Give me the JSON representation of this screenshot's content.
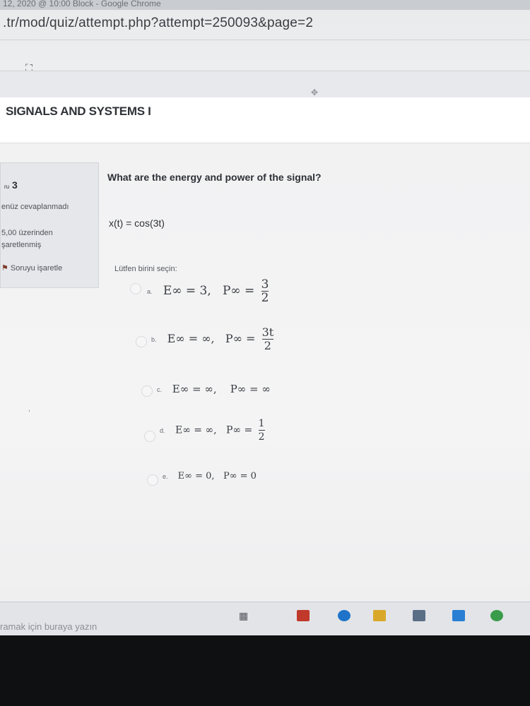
{
  "browser": {
    "tab_title": "12, 2020 @ 10:00 Block - Google Chrome",
    "url": ".tr/mod/quiz/attempt.php?attempt=250093&page=2"
  },
  "course": {
    "title": "SIGNALS AND SYSTEMS I"
  },
  "question_info": {
    "number": "3",
    "number_prefix": "ru",
    "state": "enüz cevaplanmadı",
    "grade_line1": "5,00 üzerinden",
    "grade_line2": "şaretlenmiş",
    "flag_label": "Soruyu işaretle"
  },
  "question": {
    "text": "What are the energy and power of the signal?",
    "formula": "x(t) = cos(3t)",
    "prompt": "Lütfen birini seçin:",
    "options": [
      {
        "letter": "a.",
        "energy": "E∞ = 3,",
        "power_label": "P∞ =",
        "num": "3",
        "den": "2"
      },
      {
        "letter": "b.",
        "energy": "E∞ = ∞,",
        "power_label": "P∞ =",
        "num": "3t",
        "den": "2"
      },
      {
        "letter": "c.",
        "energy": "E∞ = ∞,",
        "power_label": "P∞ = ∞"
      },
      {
        "letter": "d.",
        "energy": "E∞ = ∞,",
        "power_label": "P∞ =",
        "num": "1",
        "den": "2"
      },
      {
        "letter": "e.",
        "energy": "E∞ = 0,",
        "power_label": "P∞ = 0"
      }
    ]
  },
  "taskbar": {
    "search_placeholder": "ramak için buraya yazın"
  },
  "icons": [
    "fullscreen-icon",
    "flag-icon",
    "task-view-icon",
    "mcafee-icon",
    "edge-icon",
    "file-explorer-icon",
    "store-icon",
    "mail-icon",
    "chrome-icon"
  ],
  "colors": {
    "background": "#f4f4f5",
    "info_box": "#e5e7ea",
    "text": "#2d3035"
  }
}
